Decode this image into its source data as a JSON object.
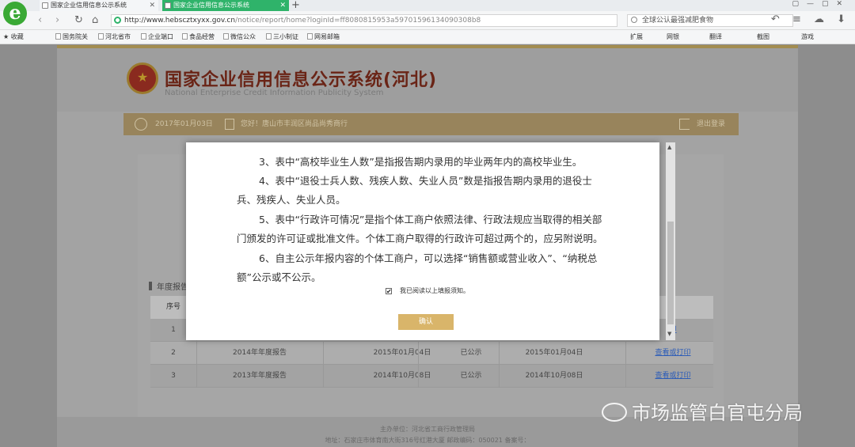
{
  "browser": {
    "tabs": [
      {
        "label": "国家企业信用信息公示系统",
        "active": false
      },
      {
        "label": "国家企业信用信息公示系统",
        "active": true
      }
    ],
    "url_domain": "http://www.hebscztxyxx.gov.cn",
    "url_path": "/notice/report/home?loginId=ff8080815953a59701596134090308b8",
    "search_text": "全球公认最强减肥食物",
    "bookmarks": [
      "收藏",
      "国务院关",
      "河北省市",
      "企业端口",
      "食品经营",
      "微信公众",
      "三小制证",
      "网易邮箱"
    ],
    "toolbar_right": [
      "扩展",
      "网银",
      "翻译",
      "截图",
      "游戏"
    ]
  },
  "site": {
    "title": "国家企业信用信息公示系统(河北)",
    "subtitle": "National Enterprise Credit Information Publicity System",
    "date": "2017年01月03日",
    "unit": "您好！唐山市丰润区尚品尚秀商行",
    "logout": "退出登录"
  },
  "section_title": "年度报告",
  "table": {
    "header_first": "序号",
    "rows": [
      {
        "no": "1",
        "name": "",
        "date1": "",
        "status": "",
        "date2": "",
        "action": "印"
      },
      {
        "no": "2",
        "name": "2014年年度报告",
        "date1": "2015年01月04日",
        "status": "已公示",
        "date2": "2015年01月04日",
        "action": "查看或打印"
      },
      {
        "no": "3",
        "name": "2013年年度报告",
        "date1": "2014年10月08日",
        "status": "已公示",
        "date2": "2014年10月08日",
        "action": "查看或打印"
      }
    ]
  },
  "footer": {
    "line1": "主办单位：河北省工商行政管理局",
    "line2": "地址：石家庄市体育南大街316号红港大厦 邮政编码：050021 备案号："
  },
  "modal": {
    "lines": [
      "3、表中“高校毕业生人数”是指报告期内录用的毕业两年内的高校毕业生。",
      "4、表中“退役士兵人数、残疾人数、失业人员”数是指报告期内录用的退役士",
      "兵、残疾人、失业人员。",
      "5、表中“行政许可情况”是指个体工商户依照法律、行政法规应当取得的相关部",
      "门颁发的许可证或批准文件。个体工商户取得的行政许可超过两个的，应另附说明。",
      "6、自主公示年报内容的个体工商户，可以选择“销售额或营业收入”、“纳税总",
      "额”公示或不公示。"
    ],
    "checkbox_label": "我已阅读以上填报须知。",
    "checkbox_mark": "✔",
    "confirm": "确认"
  },
  "watermark": "市场监管白官屯分局"
}
